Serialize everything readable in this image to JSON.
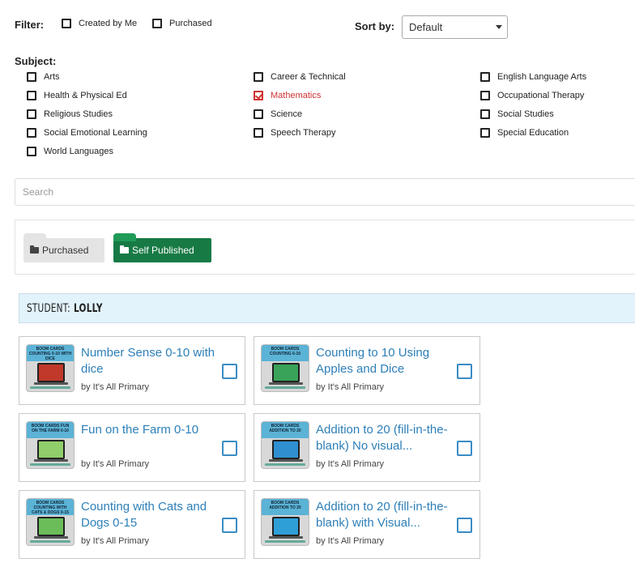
{
  "filter": {
    "label": "Filter:",
    "options": [
      {
        "label": "Created by Me",
        "checked": false
      },
      {
        "label": "Purchased",
        "checked": false
      }
    ]
  },
  "sort": {
    "label": "Sort by:",
    "selected": "Default"
  },
  "subject": {
    "label": "Subject:",
    "items": [
      {
        "label": "Arts",
        "checked": false
      },
      {
        "label": "Career & Technical",
        "checked": false
      },
      {
        "label": "English Language Arts",
        "checked": false
      },
      {
        "label": "Health & Physical Ed",
        "checked": false
      },
      {
        "label": "Mathematics",
        "checked": true
      },
      {
        "label": "Occupational Therapy",
        "checked": false
      },
      {
        "label": "Religious Studies",
        "checked": false
      },
      {
        "label": "Science",
        "checked": false
      },
      {
        "label": "Social Studies",
        "checked": false
      },
      {
        "label": "Social Emotional Learning",
        "checked": false
      },
      {
        "label": "Speech Therapy",
        "checked": false
      },
      {
        "label": "Special Education",
        "checked": false
      },
      {
        "label": "World Languages",
        "checked": false
      }
    ]
  },
  "search": {
    "placeholder": "Search",
    "value": ""
  },
  "tabs": [
    {
      "label": "Purchased",
      "active": false,
      "icon": "folder-icon"
    },
    {
      "label": "Self Published",
      "active": true,
      "icon": "folder-icon"
    }
  ],
  "student": {
    "prefix": "Student:",
    "name": "Lolly"
  },
  "cards": [
    {
      "title": "Number Sense 0-10 with dice",
      "author": "by It's All Primary",
      "thumb_text": "BOOM CARDS COUNTING 0-10 WITH DICE",
      "screen_color": "#c0392b",
      "checked": false
    },
    {
      "title": "Counting to 10 Using Apples and Dice",
      "author": "by It's All Primary",
      "thumb_text": "BOOM CARDS COUNTING 0-10",
      "screen_color": "#3aa35a",
      "checked": false
    },
    {
      "title": "Fun on the Farm 0-10",
      "author": "by It's All Primary",
      "thumb_text": "BOOM CARDS FUN ON THE FARM 0-10",
      "screen_color": "#8fce6a",
      "checked": false
    },
    {
      "title": "Addition to 20 (fill-in-the-blank) No visual...",
      "author": "by It's All Primary",
      "thumb_text": "BOOM CARDS ADDITION TO 20",
      "screen_color": "#2f8fd0",
      "checked": false
    },
    {
      "title": "Counting with Cats and Dogs 0-15",
      "author": "by It's All Primary",
      "thumb_text": "BOOM CARDS COUNTING WITH CATS & DOGS 0-15",
      "screen_color": "#6bbd5a",
      "checked": false
    },
    {
      "title": "Addition to 20 (fill-in-the-blank) with Visual...",
      "author": "by It's All Primary",
      "thumb_text": "BOOM CARDS ADDITION TO 20",
      "screen_color": "#2f9fd8",
      "checked": false
    }
  ],
  "colors": {
    "accent_blue": "#2d7fb8",
    "checked_red": "#d03232",
    "self_published_green": "#177a45",
    "banner_bg": "#e3f3fb"
  }
}
